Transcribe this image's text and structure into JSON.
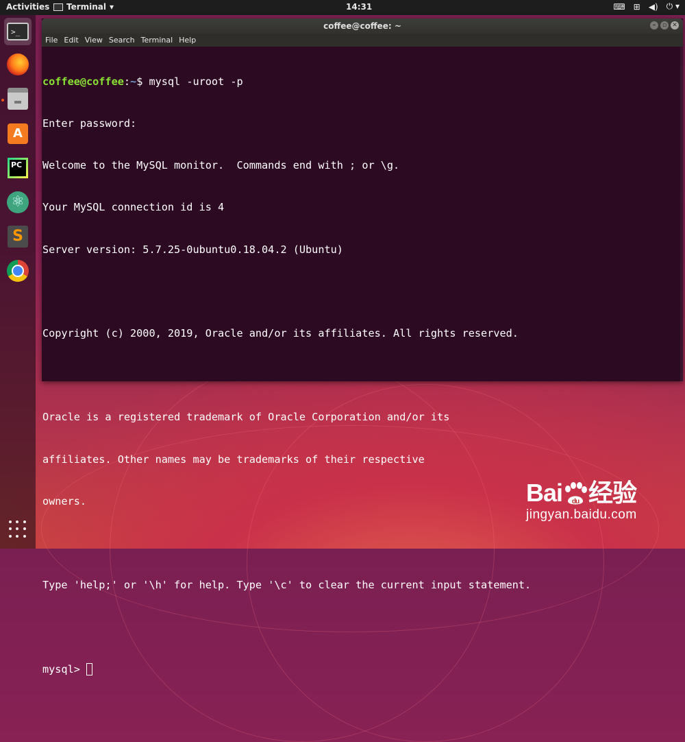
{
  "topbar": {
    "activities": "Activities",
    "app_name": "Terminal",
    "clock": "14:31",
    "tray_icons": [
      "keyboard-icon",
      "network-icon",
      "volume-icon",
      "power-icon"
    ]
  },
  "dock": {
    "items": [
      {
        "name": "terminal",
        "icon": "terminal-icon",
        "active": true
      },
      {
        "name": "firefox",
        "icon": "firefox-icon"
      },
      {
        "name": "files",
        "icon": "files-icon",
        "running": true
      },
      {
        "name": "software",
        "icon": "software-store-icon"
      },
      {
        "name": "pycharm",
        "icon": "pycharm-icon",
        "label": "PC"
      },
      {
        "name": "atom",
        "icon": "atom-icon"
      },
      {
        "name": "sublime",
        "icon": "sublime-text-icon",
        "label": "S"
      },
      {
        "name": "chrome",
        "icon": "chrome-icon"
      }
    ],
    "show_apps_icon": "show-applications-icon"
  },
  "window": {
    "title": "coffee@coffee: ~",
    "menu": [
      "File",
      "Edit",
      "View",
      "Search",
      "Terminal",
      "Help"
    ]
  },
  "terminal": {
    "prompt_user": "coffee@coffee",
    "prompt_sep": ":",
    "prompt_path": "~",
    "prompt_symbol": "$ ",
    "command": "mysql -uroot -p",
    "lines": [
      "Enter password:",
      "Welcome to the MySQL monitor.  Commands end with ; or \\g.",
      "Your MySQL connection id is 4",
      "Server version: 5.7.25-0ubuntu0.18.04.2 (Ubuntu)",
      "",
      "Copyright (c) 2000, 2019, Oracle and/or its affiliates. All rights reserved.",
      "",
      "Oracle is a registered trademark of Oracle Corporation and/or its",
      "affiliates. Other names may be trademarks of their respective",
      "owners.",
      "",
      "Type 'help;' or '\\h' for help. Type '\\c' to clear the current input statement.",
      ""
    ],
    "mysql_prompt": "mysql> "
  },
  "watermark": {
    "logo_left": "Bai",
    "logo_right": "经验",
    "url": "jingyan.baidu.com"
  }
}
